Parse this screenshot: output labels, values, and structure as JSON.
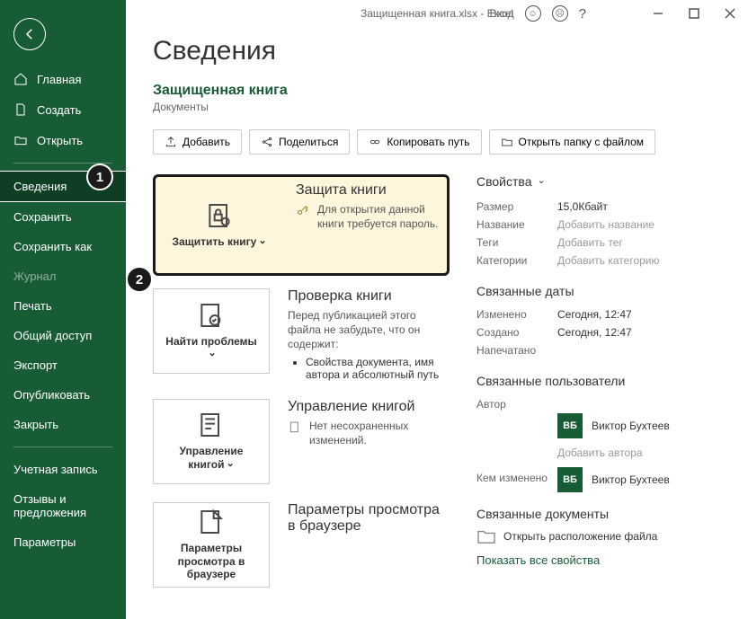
{
  "titlebar": "Защищенная книга.xlsx  -  Excel",
  "login": "Вход",
  "nav": {
    "home": "Главная",
    "new": "Создать",
    "open": "Открыть",
    "info": "Сведения",
    "save": "Сохранить",
    "saveas": "Сохранить как",
    "history": "Журнал",
    "print": "Печать",
    "share": "Общий доступ",
    "export": "Экспорт",
    "publish": "Опубликовать",
    "close": "Закрыть",
    "account": "Учетная запись",
    "feedback": "Отзывы и предложения",
    "options": "Параметры"
  },
  "page": {
    "title": "Сведения",
    "subtitle": "Защищенная книга",
    "subpath": "Документы"
  },
  "actions": {
    "upload": "Добавить",
    "share": "Поделиться",
    "copypath": "Копировать путь",
    "openfolder": "Открыть папку с файлом"
  },
  "cards": {
    "protect": {
      "label": "Защитить книгу",
      "title": "Защита книги",
      "desc": "Для открытия данной книги требуется пароль."
    },
    "inspect": {
      "label": "Найти проблемы",
      "title": "Проверка книги",
      "desc": "Перед публикацией этого файла не забудьте, что он содержит:",
      "bullet": "Свойства документа, имя автора и абсолютный путь"
    },
    "manage": {
      "label": "Управление книгой",
      "title": "Управление книгой",
      "desc": "Нет несохраненных изменений."
    },
    "browser": {
      "label": "Параметры просмотра в браузере",
      "title": "Параметры просмотра в браузере"
    }
  },
  "props": {
    "title": "Свойства",
    "size_l": "Размер",
    "size_v": "15,0Кбайт",
    "name_l": "Название",
    "name_v": "Добавить название",
    "tags_l": "Теги",
    "tags_v": "Добавить тег",
    "cat_l": "Категории",
    "cat_v": "Добавить категорию"
  },
  "dates": {
    "title": "Связанные даты",
    "modified_l": "Изменено",
    "modified_v": "Сегодня, 12:47",
    "created_l": "Создано",
    "created_v": "Сегодня, 12:47",
    "printed_l": "Напечатано"
  },
  "users": {
    "title": "Связанные пользователи",
    "author_l": "Автор",
    "author_initials": "ВБ",
    "author_name": "Виктор Бухтеев",
    "add_author": "Добавить автора",
    "modifier_l": "Кем изменено",
    "modifier_initials": "ВБ",
    "modifier_name": "Виктор Бухтеев"
  },
  "docs": {
    "title": "Связанные документы",
    "open_loc": "Открыть расположение файла",
    "show_all": "Показать все свойства"
  },
  "badges": {
    "one": "1",
    "two": "2"
  }
}
